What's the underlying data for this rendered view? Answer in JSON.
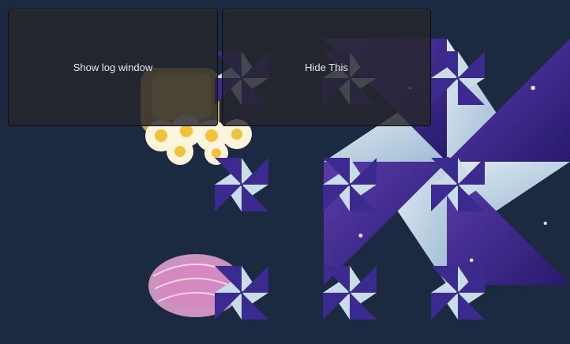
{
  "buttons": {
    "show_log": "Show log window",
    "hide": "Hide This"
  },
  "colors": {
    "background": "#1b2a40",
    "button_bg": "#26262c",
    "button_text": "#e8e8e8",
    "pinwheel_dark": "#3a2c8a",
    "pinwheel_light": "#c9dcea",
    "flower_petal": "#fff6dc",
    "flower_center": "#f0c23a",
    "basket_pink": "#e9a7d4"
  },
  "sprites": [
    {
      "icon": "pinwheel-icon",
      "kind": "large"
    },
    {
      "icon": "pinwheel-icon",
      "kind": "small"
    },
    {
      "icon": "flower-cake-icon"
    },
    {
      "icon": "basket-icon"
    }
  ]
}
